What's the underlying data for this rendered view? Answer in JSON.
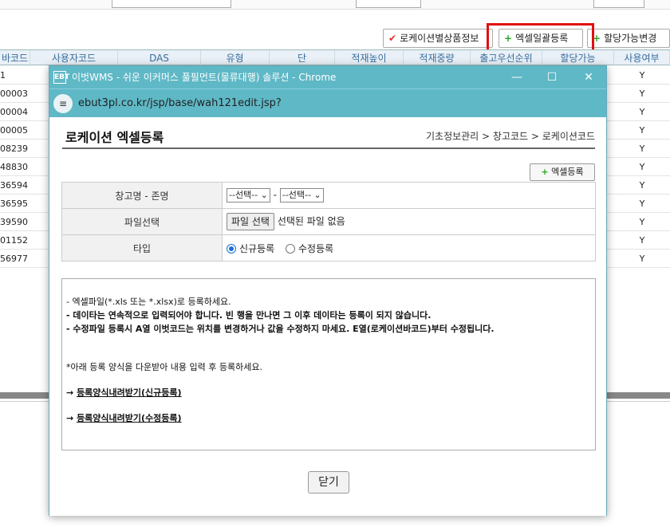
{
  "background": {
    "buttons": {
      "loc_product_info": "로케이션별상품정보",
      "excel_bulk": "엑셀일괄등록",
      "allocatable_change": "할당가능변경"
    },
    "columns": [
      "바코드",
      "사용자코드",
      "DAS",
      "유형",
      "단",
      "적재높이",
      "적재중량",
      "출고우선순위",
      "할당가능",
      "사용여부"
    ],
    "rows": [
      {
        "code": "1",
        "use": "Y"
      },
      {
        "code": "00003",
        "use": "Y"
      },
      {
        "code": "00004",
        "use": "Y"
      },
      {
        "code": "00005",
        "use": "Y"
      },
      {
        "code": "08239",
        "use": "Y"
      },
      {
        "code": "48830",
        "use": "Y"
      },
      {
        "code": "36594",
        "use": "Y"
      },
      {
        "code": "36595",
        "use": "Y"
      },
      {
        "code": "39590",
        "use": "Y"
      },
      {
        "code": "01152",
        "use": "Y"
      },
      {
        "code": "56977",
        "use": "Y"
      }
    ]
  },
  "popup": {
    "window_title": "이벗WMS - 쉬운 이커머스 풀필먼트(물류대행) 솔루션 - Chrome",
    "logo_text": "EBT",
    "url": "ebut3pl.co.kr/jsp/base/wah121edit.jsp?",
    "page_title": "로케이션 엑셀등록",
    "breadcrumb": "기초정보관리 > 창고코드 > 로케이션코드",
    "excel_register_btn": "엑셀등록",
    "form": {
      "warehouse_label": "창고명 - 존명",
      "select1": "--선택--",
      "dash": "-",
      "select2": "--선택--",
      "file_label": "파일선택",
      "file_btn": "파일 선택",
      "file_none": "선택된 파일 없음",
      "type_label": "타입",
      "radio_new": "신규등록",
      "radio_edit": "수정등록"
    },
    "notice": {
      "line1": "- 엑셀파일(*.xls 또는 *.xlsx)로 등록하세요.",
      "line2": "- 데이타는 연속적으로 입력되어야 합니다. 빈 행을 만나면 그 이후 데이타는 등록이 되지 않습니다.",
      "line3": "- 수정파일 등록시 A열 이벗코드는 위치를 변경하거나 값을 수정하지 마세요. E열(로케이션바코드)부터 수정됩니다.",
      "line4": "*아래 등록 양식을 다운받아 내용 입력 후 등록하세요.",
      "arrow": "→",
      "link_new": "등록양식내려받기(신규등록)",
      "link_edit": "등록양식내려받기(수정등록)"
    },
    "close_btn": "닫기"
  }
}
